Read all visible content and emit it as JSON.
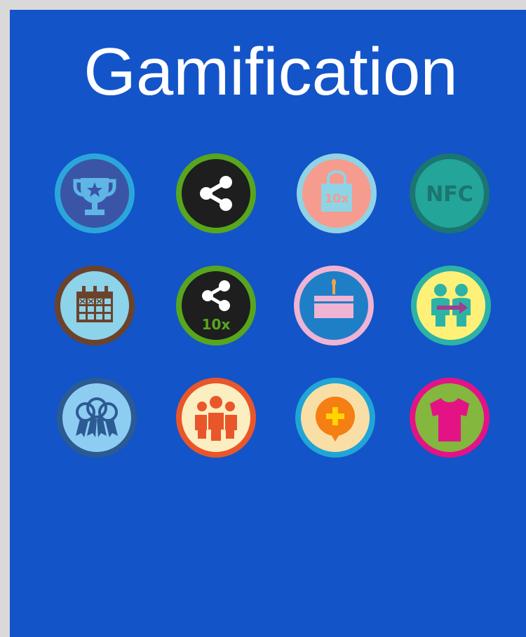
{
  "page": {
    "title": "Gamification"
  },
  "badges": [
    {
      "name": "trophy-badge-icon"
    },
    {
      "name": "share-badge-icon"
    },
    {
      "name": "shopping-bag-10x-badge-icon",
      "label": "10x"
    },
    {
      "name": "nfc-badge-icon",
      "label": "NFC"
    },
    {
      "name": "calendar-badge-icon"
    },
    {
      "name": "share-10x-badge-icon",
      "label": "10x"
    },
    {
      "name": "birthday-cake-badge-icon"
    },
    {
      "name": "refer-friend-badge-icon"
    },
    {
      "name": "award-ribbons-badge-icon"
    },
    {
      "name": "group-badge-icon"
    },
    {
      "name": "chat-plus-badge-icon"
    },
    {
      "name": "tshirt-badge-icon"
    }
  ]
}
